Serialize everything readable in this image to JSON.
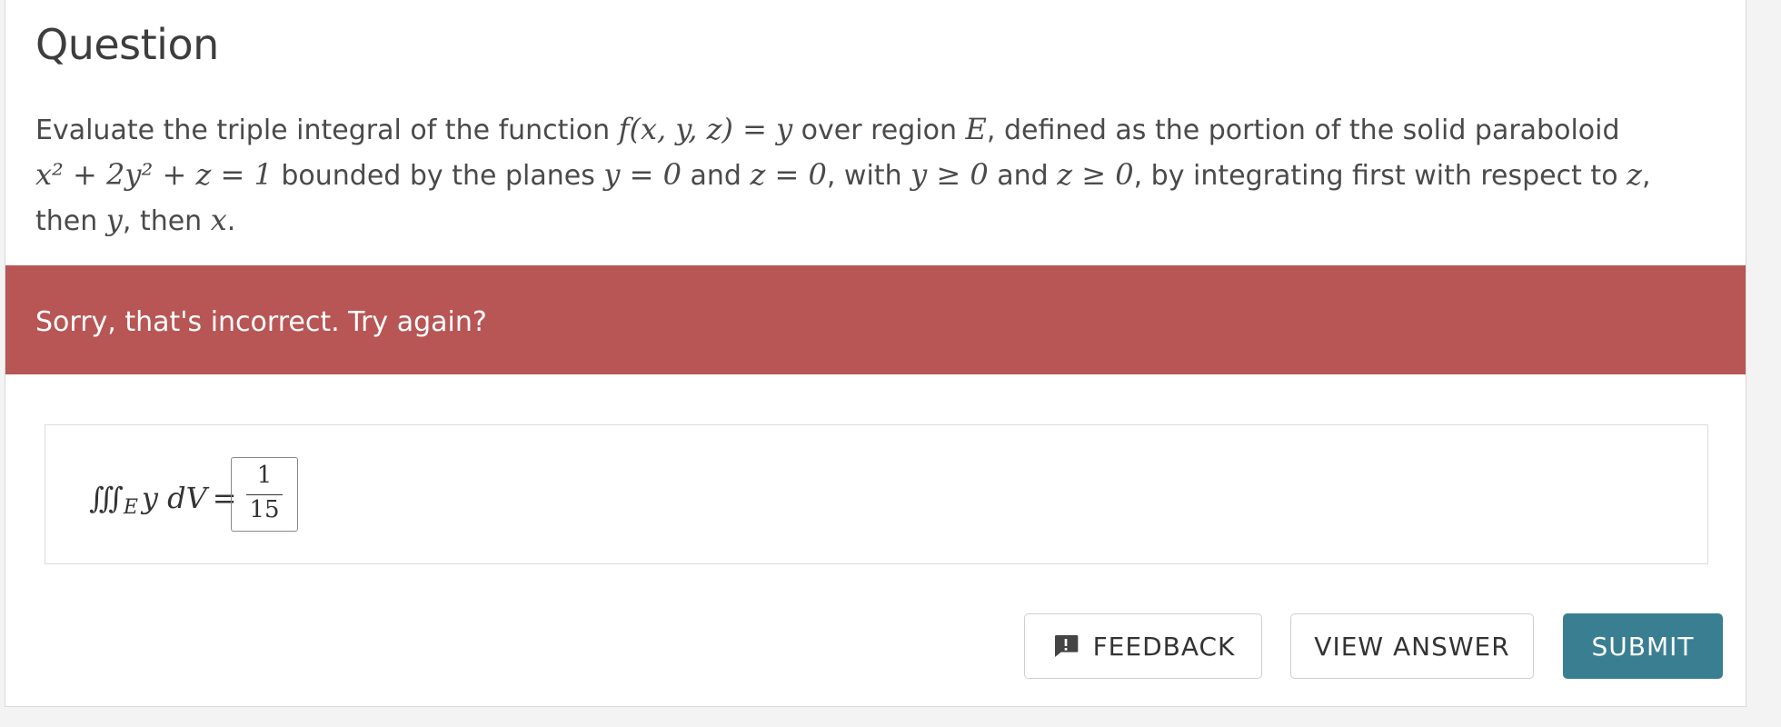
{
  "question": {
    "title": "Question",
    "text": {
      "t1": "Evaluate the triple integral of the function ",
      "f": "f",
      "args": "(x, y, z) = y",
      "t2": " over region ",
      "E": "E",
      "t3": ", defined as the portion of the solid paraboloid",
      "eq_line": "x² + 2y² + z = 1",
      "t4": " bounded by the planes ",
      "y0": "y = 0",
      "and1": " and ",
      "z0": "z = 0",
      "t5": ", with ",
      "yge": "y ≥ 0",
      "and2": " and ",
      "zge": "z ≥ 0",
      "t6": ", by integrating first with respect to ",
      "zvar": "z",
      "t7": ",",
      "t8": "then ",
      "yvar": "y",
      "t9": ", then ",
      "xvar": "x",
      "t10": "."
    }
  },
  "feedback_banner": {
    "text": "Sorry, that's incorrect. Try again?",
    "color": "#b85655"
  },
  "answer": {
    "integral": "∭",
    "region": "E",
    "integrand": "y dV",
    "equals": "=",
    "numerator": "1",
    "denominator": "15"
  },
  "buttons": {
    "feedback": "FEEDBACK",
    "view_answer": "VIEW ANSWER",
    "submit": "SUBMIT",
    "submit_color": "#3a7f91"
  },
  "icons": {
    "feedback": "feedback-icon"
  }
}
